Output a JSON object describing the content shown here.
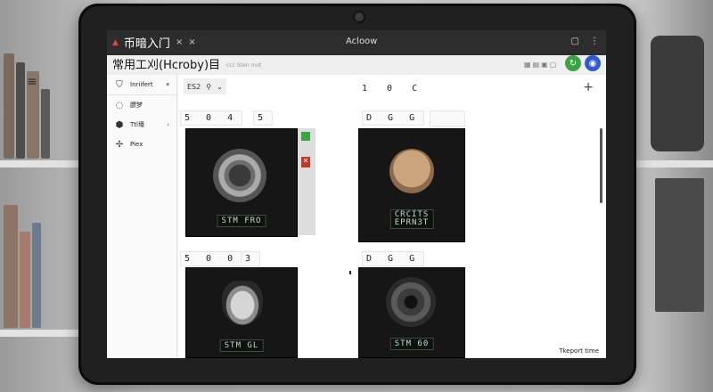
{
  "window": {
    "tab_title": "币暗入门",
    "tab_close": "×",
    "tab_close2": "×",
    "title": "Acloow",
    "subtitle": "常用工刈(Hcroby)目",
    "subheader_mid": "ccc Sten mot"
  },
  "sidebar": {
    "items": [
      {
        "icon": "shield-icon",
        "label": "Inriifert",
        "chevron": "▾"
      },
      {
        "icon": "chat-icon",
        "label": "膘梦"
      },
      {
        "icon": "box-icon",
        "label": "Ttl壕",
        "chevron": "›"
      },
      {
        "icon": "sparkle-icon",
        "label": "Piex"
      }
    ]
  },
  "toolbar": {
    "label": "ES2",
    "icon": "pin-icon",
    "chevron": "⌄"
  },
  "columns": {
    "header_right": "1 0 C"
  },
  "grid": [
    {
      "digits_a": "5 0 4",
      "digits_b": "5",
      "readout": "STM FRO"
    },
    {
      "digits_a": "D G G",
      "digits_b": "",
      "readout_l1": "CRCITS",
      "readout_l2": "EPRN3T"
    },
    {
      "digits_a": "5 0 0",
      "digits_b": "3",
      "readout": "STM GL"
    },
    {
      "digits_a": "D G G",
      "digits_b": "",
      "readout": "STM 60"
    }
  ],
  "footer": {
    "label": "Tkeport time"
  },
  "colors": {
    "accent_green": "#3aa344",
    "accent_blue": "#2f5bd0",
    "warn_red": "#e0443a"
  }
}
